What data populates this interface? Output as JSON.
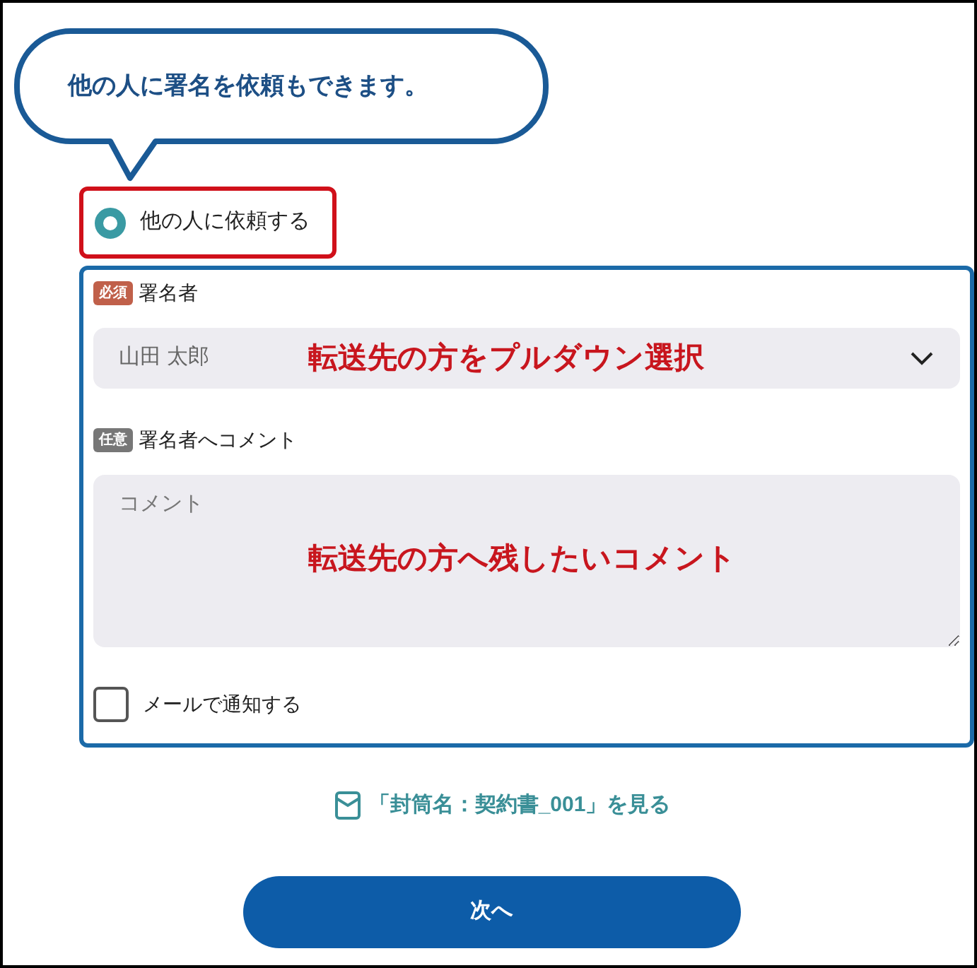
{
  "callout": {
    "text": "他の人に署名を依頼もできます。"
  },
  "radio": {
    "label": "他の人に依頼する",
    "selected": true
  },
  "signer": {
    "badge": "必須",
    "label": "署名者",
    "value": "山田 太郎",
    "annotation": "転送先の方をプルダウン選択"
  },
  "comment": {
    "badge": "任意",
    "label": "署名者へコメント",
    "placeholder": "コメント",
    "annotation": "転送先の方へ残したいコメント"
  },
  "notify": {
    "label": "メールで通知する",
    "checked": false
  },
  "envelope_link": "「封筒名：契約書_001」を見る",
  "next_button": "次へ"
}
